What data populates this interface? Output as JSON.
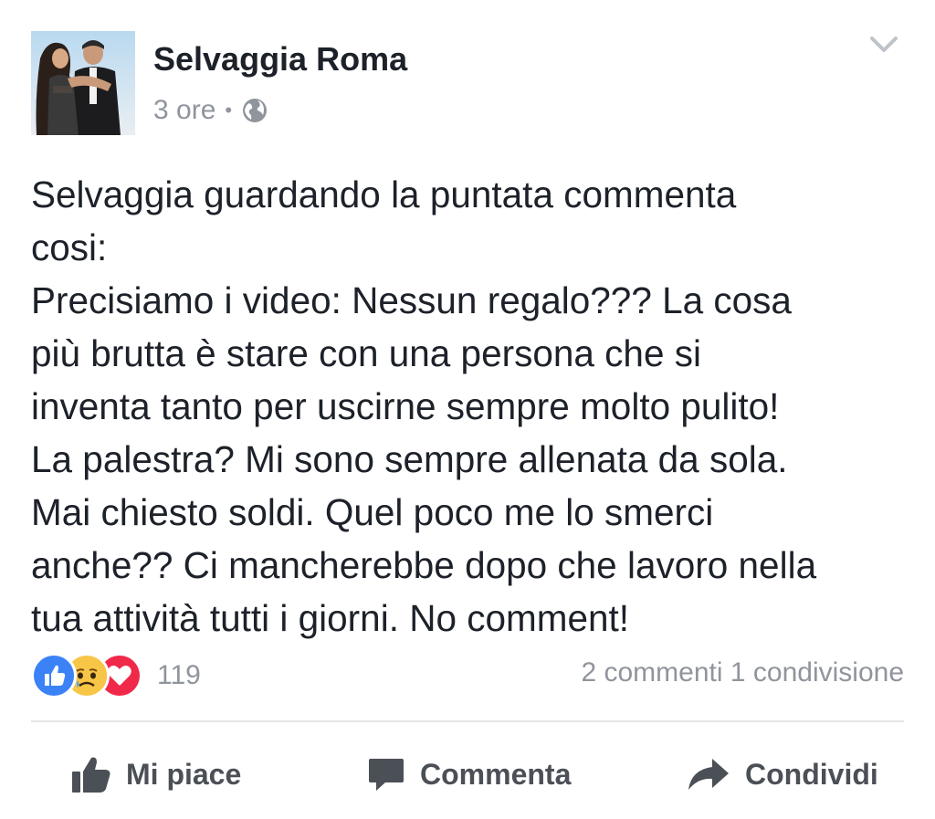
{
  "post": {
    "author": "Selvaggia Roma",
    "time": "3 ore",
    "separator": "•",
    "privacy_icon": "globe-icon",
    "menu_icon": "chevron-down-icon",
    "lines": [
      "Selvaggia guardando la puntata commenta",
      "cosi:",
      "Precisiamo i video: Nessun regalo??? La cosa",
      "più brutta è stare con una persona che si",
      "inventa tanto per uscirne sempre molto pulito!",
      "La palestra? Mi sono sempre allenata da sola.",
      "Mai chiesto soldi. Quel poco me lo smerci",
      "anche?? Ci mancherebbe dopo che lavoro nella",
      "tua attività tutti i giorni. No comment!"
    ]
  },
  "reactions": {
    "icons": [
      "like-reaction-icon",
      "sad-reaction-icon",
      "love-reaction-icon"
    ],
    "count": "119",
    "comments": "2 commenti",
    "shares": "1 condivisione"
  },
  "actions": {
    "like": "Mi piace",
    "comment": "Commenta",
    "share": "Condividi"
  },
  "colors": {
    "text": "#1d2129",
    "muted": "#90949c",
    "action": "#4b4f56",
    "like_blue": "#3b82f6",
    "love_red": "#f0284a",
    "sad_yellow": "#f7c646"
  }
}
